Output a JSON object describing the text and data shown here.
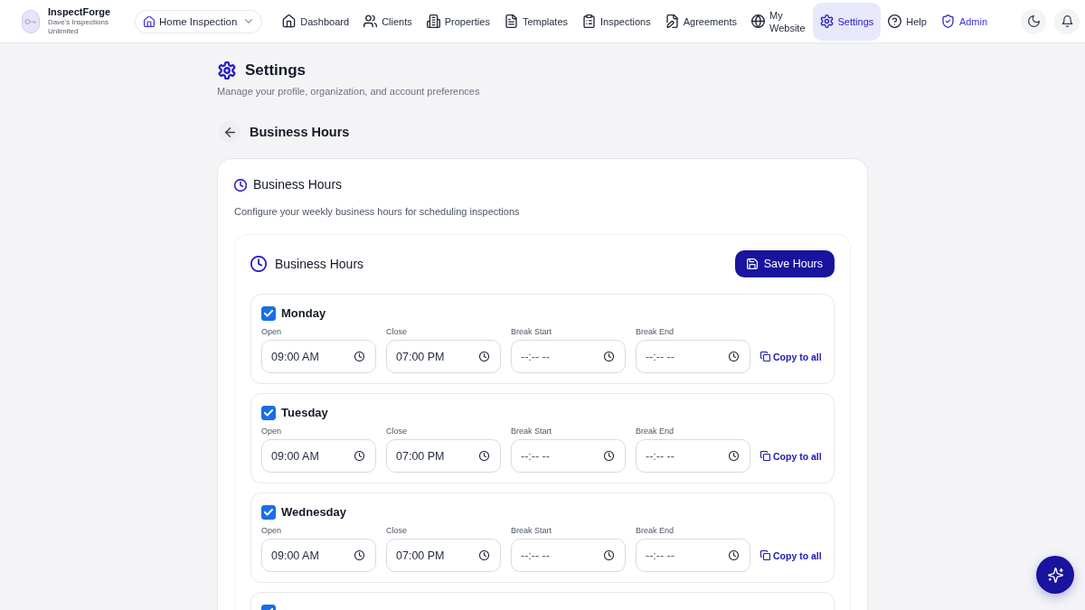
{
  "app": {
    "name": "InspectForge",
    "organization": "Dave's Inspections Unlimited"
  },
  "workspace_selector": {
    "label": "Home Inspection"
  },
  "nav": [
    {
      "label": "Dashboard",
      "selected": false,
      "kind": "page"
    },
    {
      "label": "Clients",
      "selected": false,
      "kind": "page"
    },
    {
      "label": "Properties",
      "selected": false,
      "kind": "page"
    },
    {
      "label": "Templates",
      "selected": false,
      "kind": "page"
    },
    {
      "label": "Inspections",
      "selected": false,
      "kind": "page"
    },
    {
      "label": "Agreements",
      "selected": false,
      "kind": "page"
    },
    {
      "label": "My Website",
      "selected": false,
      "kind": "page"
    },
    {
      "label": "Settings",
      "selected": true,
      "kind": "page"
    },
    {
      "label": "Help",
      "selected": false,
      "kind": "page"
    },
    {
      "label": "Admin",
      "selected": false,
      "kind": "admin"
    }
  ],
  "page": {
    "title": "Settings",
    "subtitle": "Manage your profile, organization, and account preferences"
  },
  "section": {
    "title": "Business Hours"
  },
  "card": {
    "title": "Business Hours",
    "description": "Configure your weekly business hours for scheduling inspections"
  },
  "hours_panel": {
    "title": "Business Hours",
    "save_button": "Save Hours",
    "days": [
      {
        "name": "Monday",
        "checked": true,
        "fields": [
          {
            "label": "Open",
            "value": "09:00 AM"
          },
          {
            "label": "Close",
            "value": "07:00 PM"
          },
          {
            "label": "Break Start",
            "placeholder": "--:-- --"
          },
          {
            "label": "Break End",
            "placeholder": "--:-- --"
          }
        ],
        "copy_link": "Copy to all"
      },
      {
        "name": "Tuesday",
        "checked": true,
        "fields": [
          {
            "label": "Open",
            "value": "09:00 AM"
          },
          {
            "label": "Close",
            "value": "07:00 PM"
          },
          {
            "label": "Break Start",
            "placeholder": "--:-- --"
          },
          {
            "label": "Break End",
            "placeholder": "--:-- --"
          }
        ],
        "copy_link": "Copy to all"
      },
      {
        "name": "Wednesday",
        "checked": true,
        "fields": [
          {
            "label": "Open",
            "value": "09:00 AM"
          },
          {
            "label": "Close",
            "value": "07:00 PM"
          },
          {
            "label": "Break Start",
            "placeholder": "--:-- --"
          },
          {
            "label": "Break End",
            "placeholder": "--:-- --"
          }
        ],
        "copy_link": "Copy to all"
      },
      {
        "checked": true
      }
    ]
  }
}
